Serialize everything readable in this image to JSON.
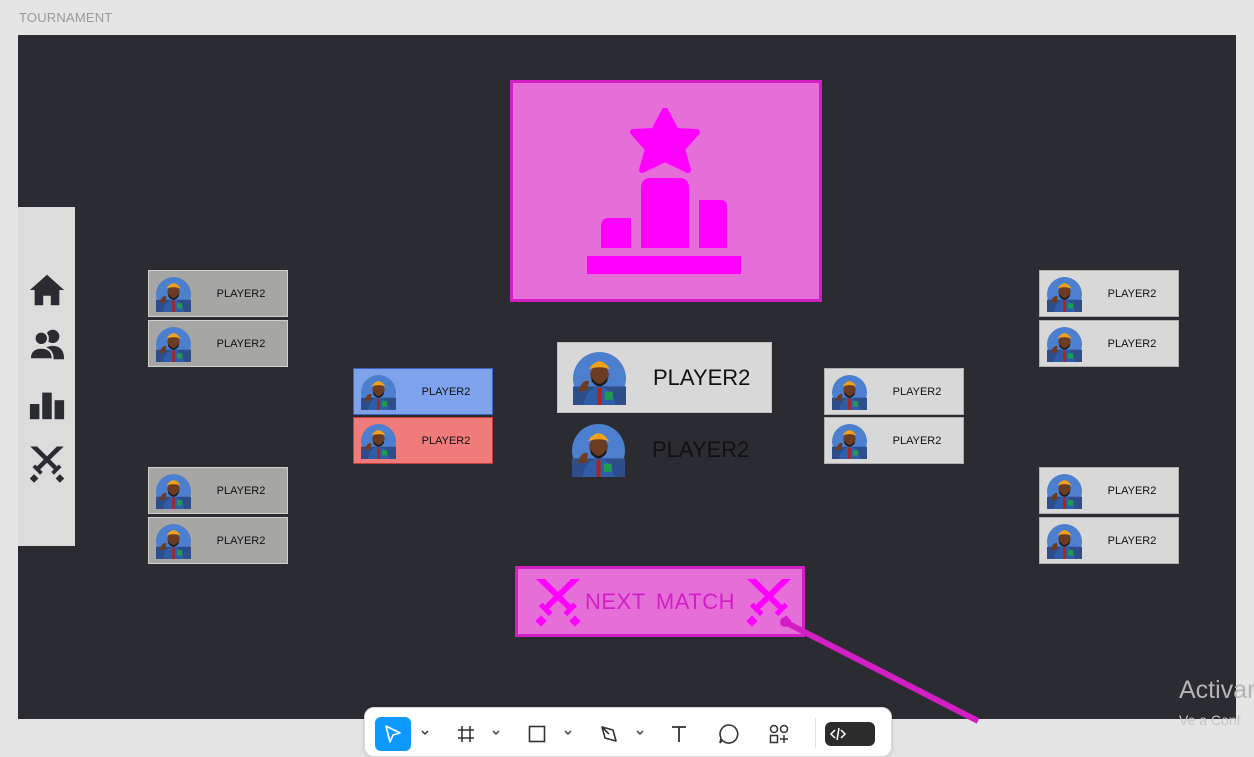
{
  "frame": {
    "label": "TOURNAMENT"
  },
  "sidebar": {
    "items": [
      {
        "icon": "home-icon"
      },
      {
        "icon": "users-icon"
      },
      {
        "icon": "leaderboard-icon"
      },
      {
        "icon": "swords-icon"
      }
    ]
  },
  "trophy": {
    "icon": "podium-star-icon"
  },
  "bracket": {
    "left_top": [
      "PLAYER2",
      "PLAYER2"
    ],
    "left_bottom": [
      "PLAYER2",
      "PLAYER2"
    ],
    "semi_left": [
      "PLAYER2",
      "PLAYER2"
    ],
    "winner": "PLAYER2",
    "second": "PLAYER2",
    "semi_right": [
      "PLAYER2",
      "PLAYER2"
    ],
    "right_top": [
      "PLAYER2",
      "PLAYER2"
    ],
    "right_bottom": [
      "PLAYER2",
      "PLAYER2"
    ]
  },
  "next_match": {
    "label": "NEXT MATCH"
  },
  "toolbar": {
    "tools": [
      "move-icon",
      "frame-icon",
      "rectangle-icon",
      "pen-icon",
      "text-icon",
      "comment-icon",
      "actions-icon",
      "dev-mode-icon"
    ]
  },
  "watermark": {
    "line1": "Activar",
    "line2": "Ve a Conf"
  },
  "colors": {
    "canvas": "#2b2c31",
    "accent": "#e66ed9",
    "accent_dark": "#d21fc4",
    "icon_magenta": "#ff00ff",
    "slot_gray": "#a6a6a4",
    "blue": "#7ea3ec",
    "red": "#ef7b7b"
  }
}
